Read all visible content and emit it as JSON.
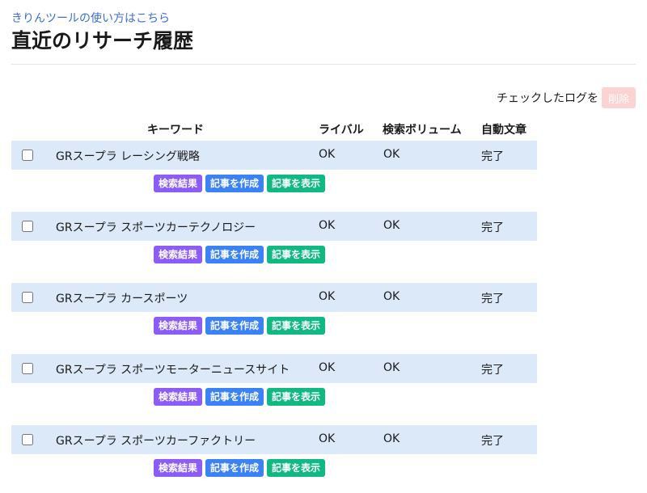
{
  "header": {
    "help_link": "きりんツールの使い方はこちら",
    "title": "直近のリサーチ履歴"
  },
  "bulk": {
    "label": "チェックしたログを",
    "delete_label": "削除"
  },
  "table": {
    "columns": {
      "keyword": "キーワード",
      "rival": "ライバル",
      "volume": "検索ボリューム",
      "auto": "自動文章"
    },
    "actions": {
      "search": "検索結果",
      "create": "記事を作成",
      "show": "記事を表示"
    },
    "rows": [
      {
        "keyword": "GRスープラ レーシング戦略",
        "rival": "OK",
        "volume": "OK",
        "auto": "完了"
      },
      {
        "keyword": "GRスープラ スポーツカーテクノロジー",
        "rival": "OK",
        "volume": "OK",
        "auto": "完了"
      },
      {
        "keyword": "GRスープラ カースポーツ",
        "rival": "OK",
        "volume": "OK",
        "auto": "完了"
      },
      {
        "keyword": "GRスープラ スポーツモーターニュースサイト",
        "rival": "OK",
        "volume": "OK",
        "auto": "完了"
      },
      {
        "keyword": "GRスープラ スポーツカーファクトリー",
        "rival": "OK",
        "volume": "OK",
        "auto": "完了"
      }
    ]
  },
  "colors": {
    "row_background": "#dce9f9",
    "search_button": "#8b5cf6",
    "create_button": "#3b82f6",
    "show_button": "#10b981",
    "delete_button": "#fbd3d3",
    "link": "#3b6fd4"
  }
}
